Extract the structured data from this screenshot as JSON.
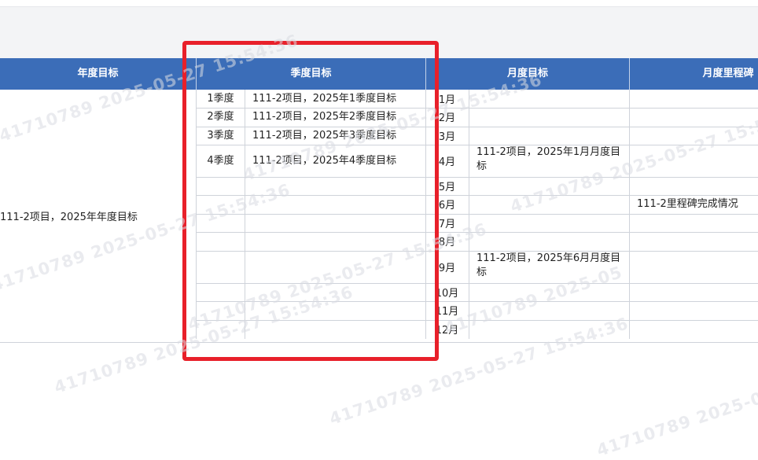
{
  "columns": {
    "annual": "年度目标",
    "quarterly": "季度目标",
    "monthly": "月度目标",
    "milestone": "月度里程碑"
  },
  "annual_goal": "111-2项目，2025年年度目标",
  "quarters": [
    {
      "label": "1季度",
      "goal": "111-2项目，2025年1季度目标"
    },
    {
      "label": "2季度",
      "goal": "111-2项目，2025年2季度目标"
    },
    {
      "label": "3季度",
      "goal": "111-2项目，2025年3季度目标"
    },
    {
      "label": "4季度",
      "goal": "111-2项目，2025年4季度目标"
    }
  ],
  "months": [
    {
      "label": "1月",
      "goal": "",
      "milestone": ""
    },
    {
      "label": "2月",
      "goal": "",
      "milestone": ""
    },
    {
      "label": "3月",
      "goal": "",
      "milestone": ""
    },
    {
      "label": "4月",
      "goal": "111-2项目，2025年1月月度目标",
      "milestone": ""
    },
    {
      "label": "5月",
      "goal": "",
      "milestone": ""
    },
    {
      "label": "6月",
      "goal": "",
      "milestone": "111-2里程碑完成情况"
    },
    {
      "label": "7月",
      "goal": "",
      "milestone": ""
    },
    {
      "label": "8月",
      "goal": "",
      "milestone": ""
    },
    {
      "label": "9月",
      "goal": "111-2项目，2025年6月月度目标",
      "milestone": ""
    },
    {
      "label": "10月",
      "goal": "",
      "milestone": ""
    },
    {
      "label": "11月",
      "goal": "",
      "milestone": ""
    },
    {
      "label": "12月",
      "goal": "",
      "milestone": ""
    }
  ],
  "watermarks": [
    "41710789 2025-05-27 15:54:36",
    "41710789 2025-05-27 15:54:36",
    "41710789 2025-05-27 15:54:36",
    "41710789 2025-05-27 15:54:36",
    "41710789 2025-05-27 15:54:36",
    "41710789 2025-05"
  ],
  "colors": {
    "header": "#3b6db8",
    "highlight": "#e8202a",
    "grid": "#cfd3da"
  }
}
